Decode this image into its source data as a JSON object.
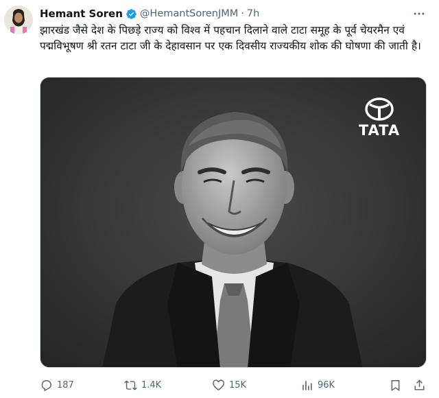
{
  "author": {
    "name": "Hemant Soren",
    "handle": "@HemantSorenJMM",
    "separator": "·",
    "time": "7h",
    "verified_color": "#1d9bf0"
  },
  "tweet": {
    "text": "झारखंड जैसे देश के पिछड़े राज्य को विश्व में पहचान दिलाने वाले टाटा समूह के पूर्व चेयरमैन एवं पद्मविभूषण श्री रतन टाटा जी के देहावसान पर एक दिवसीय राज्यकीय शोक की घोषणा की जाती है।"
  },
  "media": {
    "logo_text": "TATA",
    "background": "#303030"
  },
  "actions": {
    "replies": "187",
    "retweets": "1.4K",
    "likes": "15K",
    "views": "96K"
  },
  "icons": {
    "more": "more-icon",
    "reply": "reply-icon",
    "retweet": "retweet-icon",
    "like": "heart-icon",
    "views": "views-icon",
    "bookmark": "bookmark-icon",
    "share": "share-icon",
    "verified": "verified-badge-icon"
  }
}
